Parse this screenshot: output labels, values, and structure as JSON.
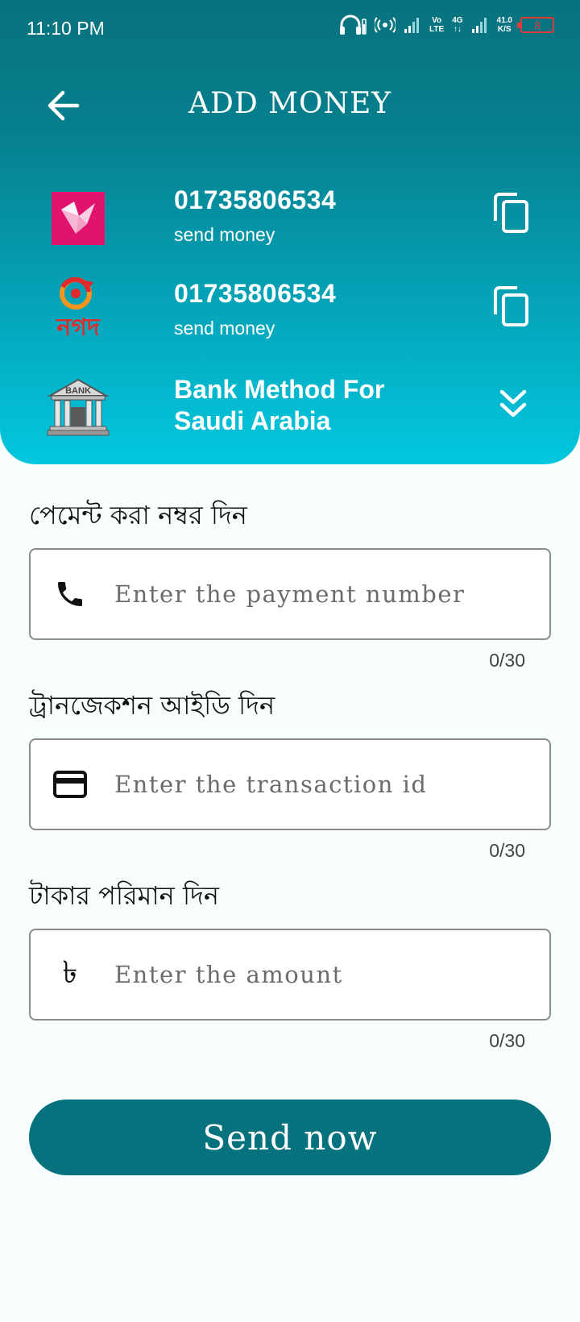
{
  "status_bar": {
    "time": "11:10 PM",
    "volte": [
      "Vo",
      "LTE"
    ],
    "network": "4G",
    "speed": [
      "41.0",
      "K/S"
    ],
    "battery": "8",
    "icons": [
      "headphones-icon",
      "hotspot-icon",
      "signal-icon",
      "signal-icon",
      "battery-icon"
    ]
  },
  "header": {
    "title": "ADD MONEY",
    "back_icon": "arrow-left-icon"
  },
  "methods": [
    {
      "logo": "bkash-logo",
      "number": "01735806534",
      "subtitle": "send money",
      "action_icon": "copy-icon"
    },
    {
      "logo": "nagad-logo",
      "logo_text": "নগদ",
      "number": "01735806534",
      "subtitle": "send money",
      "action_icon": "copy-icon"
    }
  ],
  "bank": {
    "logo_text": "BANK",
    "title_line1": "Bank Method For",
    "title_line2": "Saudi Arabia",
    "action_icon": "chevron-double-down-icon"
  },
  "form": {
    "payment": {
      "label": "পেমেন্ট করা নম্বর দিন",
      "placeholder": "Enter the payment number",
      "value": "",
      "counter": "0/30",
      "icon": "phone-icon"
    },
    "transaction": {
      "label": "ট্রানজেকশন আইডি দিন",
      "placeholder": "Enter the transaction id",
      "value": "",
      "counter": "0/30",
      "icon": "card-icon"
    },
    "amount": {
      "label": "টাকার পরিমান দিন",
      "placeholder": "Enter the amount",
      "value": "",
      "counter": "0/30",
      "icon": "taka-icon",
      "icon_glyph": "৳"
    }
  },
  "submit_label": "Send now",
  "colors": {
    "primary": "#05727e",
    "header_top": "#08727e",
    "header_bottom": "#02c8df",
    "bkash": "#e2136e",
    "nagad_red": "#e22a2a",
    "nagad_orange": "#f7941d",
    "battery_low": "#e23a3a"
  }
}
